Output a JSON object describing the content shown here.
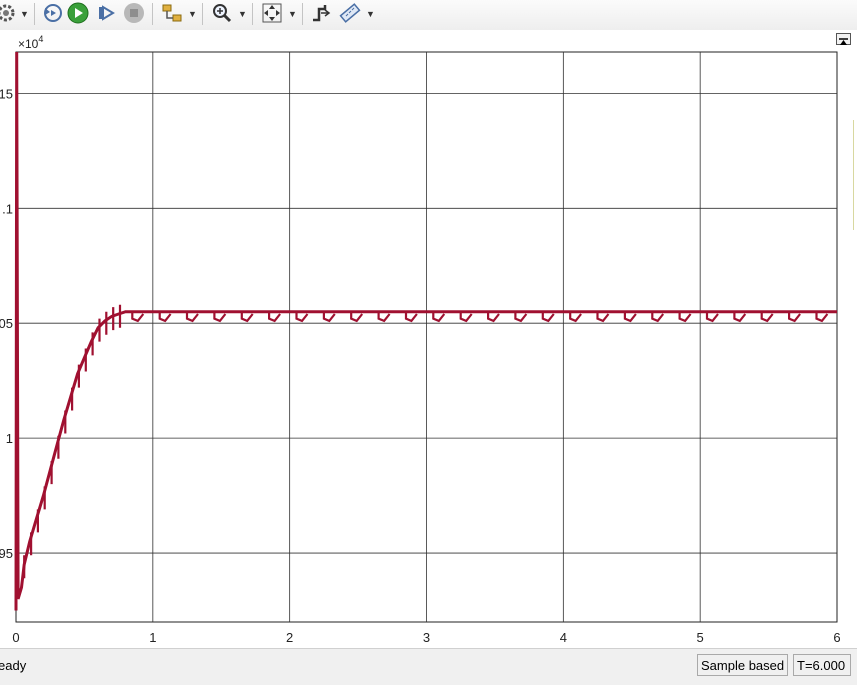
{
  "status": {
    "ready_text": "eady",
    "sample_mode": "Sample based",
    "sim_time": "T=6.000"
  },
  "colors": {
    "signal": "#a01030",
    "grid": "#303030",
    "toolbar_bg": "#f0f0f0"
  },
  "toolbar_icons": [
    "settings-icon",
    "step-back-icon",
    "run-icon",
    "step-forward-icon",
    "stop-icon",
    "highlight-icon",
    "zoom-in-icon",
    "fit-view-icon",
    "triggers-icon",
    "measurements-icon"
  ],
  "chart_data": {
    "type": "line",
    "title": "",
    "xlabel": "",
    "ylabel": "",
    "exponent_label": "×10",
    "exponent_power": "4",
    "xlim": [
      0,
      6
    ],
    "ylim": [
      0.92,
      1.168
    ],
    "x_ticks": [
      "0",
      "1",
      "2",
      "3",
      "4",
      "5",
      "6"
    ],
    "y_ticks": [
      {
        "value": 0.95,
        "label": ".95"
      },
      {
        "value": 1.0,
        "label": "1"
      },
      {
        "value": 1.05,
        "label": "05"
      },
      {
        "value": 1.1,
        "label": ".1"
      },
      {
        "value": 1.15,
        "label": "15"
      }
    ],
    "grid": true,
    "series": [
      {
        "color": "#a01030",
        "points": [
          [
            0.0,
            0.925
          ],
          [
            0.005,
            1.168
          ],
          [
            0.015,
            0.93
          ],
          [
            0.04,
            0.935
          ],
          [
            0.06,
            0.945
          ],
          [
            0.1,
            0.955
          ],
          [
            0.15,
            0.965
          ],
          [
            0.2,
            0.975
          ],
          [
            0.25,
            0.986
          ],
          [
            0.3,
            0.997
          ],
          [
            0.35,
            1.008
          ],
          [
            0.4,
            1.018
          ],
          [
            0.45,
            1.028
          ],
          [
            0.5,
            1.035
          ],
          [
            0.55,
            1.042
          ],
          [
            0.6,
            1.048
          ],
          [
            0.65,
            1.051
          ],
          [
            0.7,
            1.053
          ],
          [
            0.75,
            1.054
          ],
          [
            0.8,
            1.055
          ],
          [
            6.0,
            1.055
          ]
        ]
      }
    ]
  }
}
